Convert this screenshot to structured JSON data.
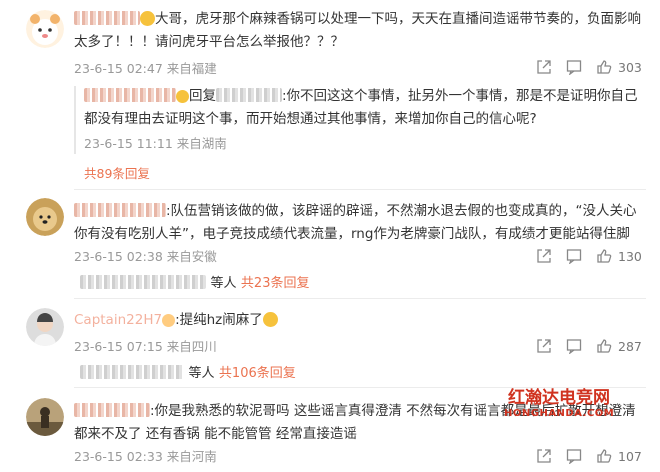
{
  "comments": [
    {
      "username": "",
      "text": "大哥，虎牙那个麻辣香锅可以处理一下吗，天天在直播间造谣带节奏的，负面影响太多了！！！请问虎牙平台怎么举报他？？？",
      "date": "23-6-15 02:47",
      "location": "来自福建",
      "likes": "303",
      "reply": {
        "username": "",
        "reply_word": "回复",
        "target": "",
        "text": ":你不回这这个事情，扯另外一个事情，那是不是证明你自己都没有理由去证明这个事，而开始想通过其他事情，来增加你自己的信心呢?",
        "date": "23-6-15 11:11",
        "location": "来自湖南"
      },
      "more_replies": "共89条回复"
    },
    {
      "username": "",
      "text": ":队伍营销该做的做，该辟谣的辟谣，不然潮水退去假的也变成真的，“没人关心你有没有吃别人羊”，电子竞技成绩代表流量，rng作为老牌豪门战队，有成绩才更能站得住脚",
      "date": "23-6-15 02:38",
      "location": "来自安徽",
      "likes": "130",
      "others": "等人",
      "more_replies": "共23条回复"
    },
    {
      "username": "Captain22H7",
      "text": ":提纯hz闹麻了",
      "date": "23-6-15 07:15",
      "location": "来自四川",
      "likes": "287",
      "others": "等人",
      "more_replies": "共106条回复"
    },
    {
      "username": "",
      "text": ":你是我熟悉的软泥哥吗 这些谣言真得澄清 不然每次有谣言都是最后扩散开想澄清都来不及了 还有香锅 能不能管管 经常直接造谣",
      "date": "23-6-15 02:33",
      "location": "来自河南",
      "likes": "107"
    }
  ],
  "watermark": {
    "line1": "红瀚达电竞网",
    "line2": "HONGHANDA.COM"
  },
  "colors": {
    "accent": "#eb7350",
    "meta": "#999999",
    "text": "#333333"
  },
  "icons": [
    "share-icon",
    "comment-icon",
    "like-icon"
  ]
}
